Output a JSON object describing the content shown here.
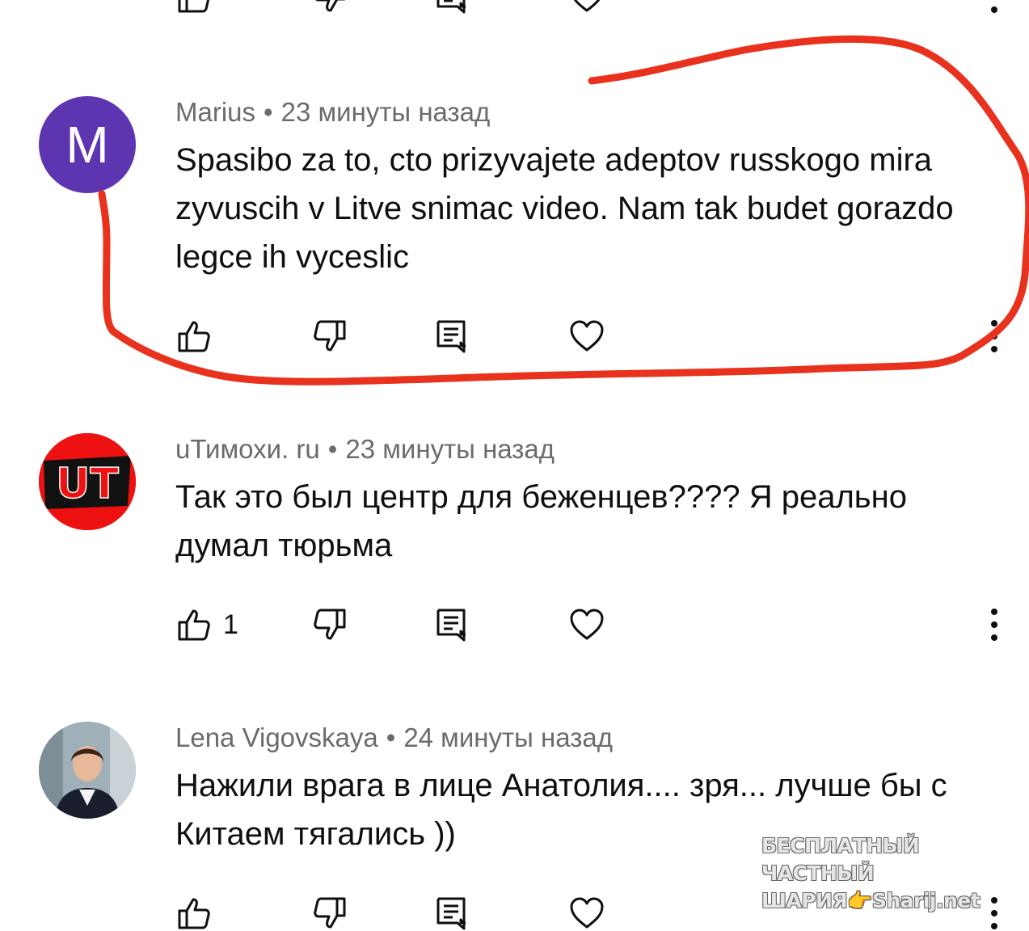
{
  "comments": [
    {
      "author": "Marius",
      "avatar_letter": "M",
      "separator": "•",
      "time": "23 минуты назад",
      "text": "Spasibo za to, cto prizyvajete adeptov russkogo mira zyvuscih v Litve snimac video. Nam tak budet gorazdo legce ih vyceslic",
      "likes": ""
    },
    {
      "author": "uТимохи. ru",
      "avatar_letter": "UT",
      "separator": "•",
      "time": "23 минуты назад",
      "text": "Так это был центр для беженцев???? Я реально думал тюрьма",
      "likes": "1"
    },
    {
      "author": "Lena Vigovskaya",
      "separator": "•",
      "time": "24 минуты назад",
      "text": "Нажили врага в лице Анатолия.... зря... лучше бы с Китаем тягались ))",
      "likes": ""
    }
  ],
  "watermark": {
    "line1": "БЕСПЛАТНЫЙ ЧАСТНЫЙ",
    "line2": "ШАРИЯ👉Sharij.net"
  },
  "colors": {
    "annotation": "#e8321e",
    "avatar_marius": "#5e35b1",
    "avatar_ut": "#ee1111",
    "meta_text": "#6b6b6b",
    "body_text": "#0f0f0f"
  },
  "icons": [
    "thumbs-up-icon",
    "thumbs-down-icon",
    "reply-icon",
    "heart-icon",
    "more-vert-icon"
  ]
}
